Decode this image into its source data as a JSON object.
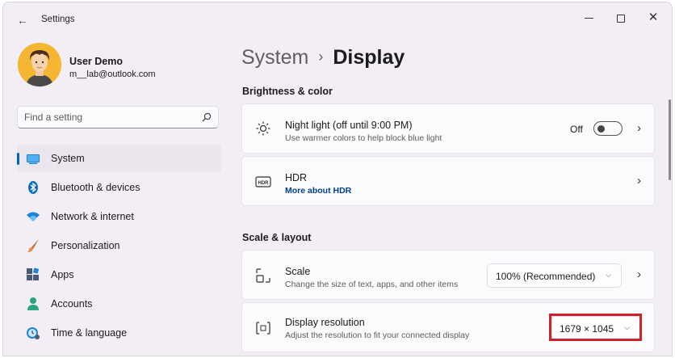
{
  "window": {
    "title": "Settings"
  },
  "user": {
    "name": "User Demo",
    "email": "m__lab@outlook.com"
  },
  "search": {
    "placeholder": "Find a setting",
    "icon": "search-icon"
  },
  "nav": {
    "items": [
      {
        "label": "System",
        "icon": "display-icon",
        "active": true
      },
      {
        "label": "Bluetooth & devices",
        "icon": "bluetooth-icon"
      },
      {
        "label": "Network & internet",
        "icon": "wifi-icon"
      },
      {
        "label": "Personalization",
        "icon": "brush-icon"
      },
      {
        "label": "Apps",
        "icon": "apps-icon"
      },
      {
        "label": "Accounts",
        "icon": "person-icon"
      },
      {
        "label": "Time & language",
        "icon": "clock-globe-icon"
      }
    ]
  },
  "breadcrumb": {
    "parent": "System",
    "separator": "›",
    "current": "Display"
  },
  "sections": {
    "brightness": {
      "title": "Brightness & color",
      "night_light": {
        "title": "Night light (off until 9:00 PM)",
        "subtitle": "Use warmer colors to help block blue light",
        "toggle_label": "Off",
        "toggle_on": false
      },
      "hdr": {
        "title": "HDR",
        "link": "More about HDR"
      }
    },
    "scale_layout": {
      "title": "Scale & layout",
      "scale": {
        "title": "Scale",
        "subtitle": "Change the size of text, apps, and other items",
        "value": "100% (Recommended)"
      },
      "resolution": {
        "title": "Display resolution",
        "subtitle": "Adjust the resolution to fit your connected display",
        "value": "1679 × 1045",
        "highlighted": true
      }
    }
  },
  "colors": {
    "accent": "#0067c0",
    "highlight": "#d0202a",
    "window_bg": "#f3eef6"
  }
}
